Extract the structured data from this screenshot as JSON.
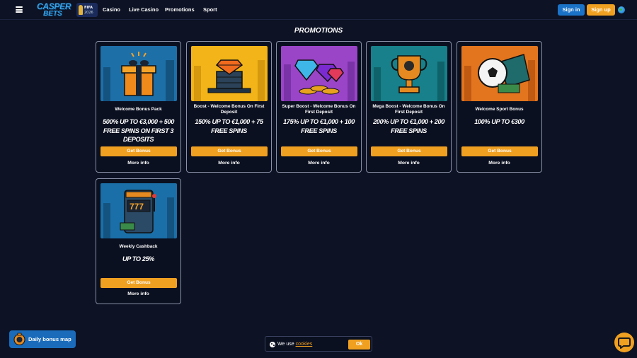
{
  "header": {
    "logo_line1": "CASPER",
    "logo_line2": "BETS",
    "fifa_line1": "FIFA",
    "fifa_line2": "2026",
    "nav": [
      "Casino",
      "Live Casino",
      "Promotions",
      "Sport"
    ],
    "signin_label": "Sign in",
    "signup_label": "Sign up"
  },
  "page_title": "PROMOTIONS",
  "promotions": [
    {
      "title": "Welcome Bonus Pack",
      "offer": "500% UP TO €3,000 + 500 FREE SPINS ON FIRST 3 DEPOSITS",
      "button": "Get Bonus",
      "more": "More info",
      "image_icon": "gift-box-icon",
      "image_bg": "#1d6fa8"
    },
    {
      "title": "Boost - Welcome Bonus On First Deposit",
      "offer": "150% UP TO €1,000 + 75 FREE SPINS",
      "button": "Get Bonus",
      "more": "More info",
      "image_icon": "diamond-on-chips-icon",
      "image_bg": "#f2b418"
    },
    {
      "title": "Super Boost - Welcome Bonus On First Deposit",
      "offer": "175% UP TO €1,000 + 100 FREE SPINS",
      "button": "Get Bonus",
      "more": "More info",
      "image_icon": "gems-and-coins-icon",
      "image_bg": "#9a45c8"
    },
    {
      "title": "Mega Boost - Welcome Bonus On First Deposit",
      "offer": "200% UP TO €1,000 + 200 FREE SPINS",
      "button": "Get Bonus",
      "more": "More info",
      "image_icon": "trophy-icon",
      "image_bg": "#17808a"
    },
    {
      "title": "Welcome Sport Bonus",
      "offer": "100% UP TO €300",
      "button": "Get Bonus",
      "more": "More info",
      "image_icon": "football-ticket-icon",
      "image_bg": "#e2751e"
    },
    {
      "title": "Weekly Cashback",
      "offer": "UP TO 25%",
      "button": "Get Bonus",
      "more": "More info",
      "image_icon": "slot-machine-icon",
      "image_bg": "#1a6fa8"
    }
  ],
  "daily_bonus": {
    "label": "Daily bonus map"
  },
  "cookie": {
    "text": "We use",
    "link": "cookies",
    "ok": "Ok"
  },
  "colors": {
    "accent": "#f0a020",
    "primary": "#1b73c8",
    "background": "#0d1224"
  }
}
